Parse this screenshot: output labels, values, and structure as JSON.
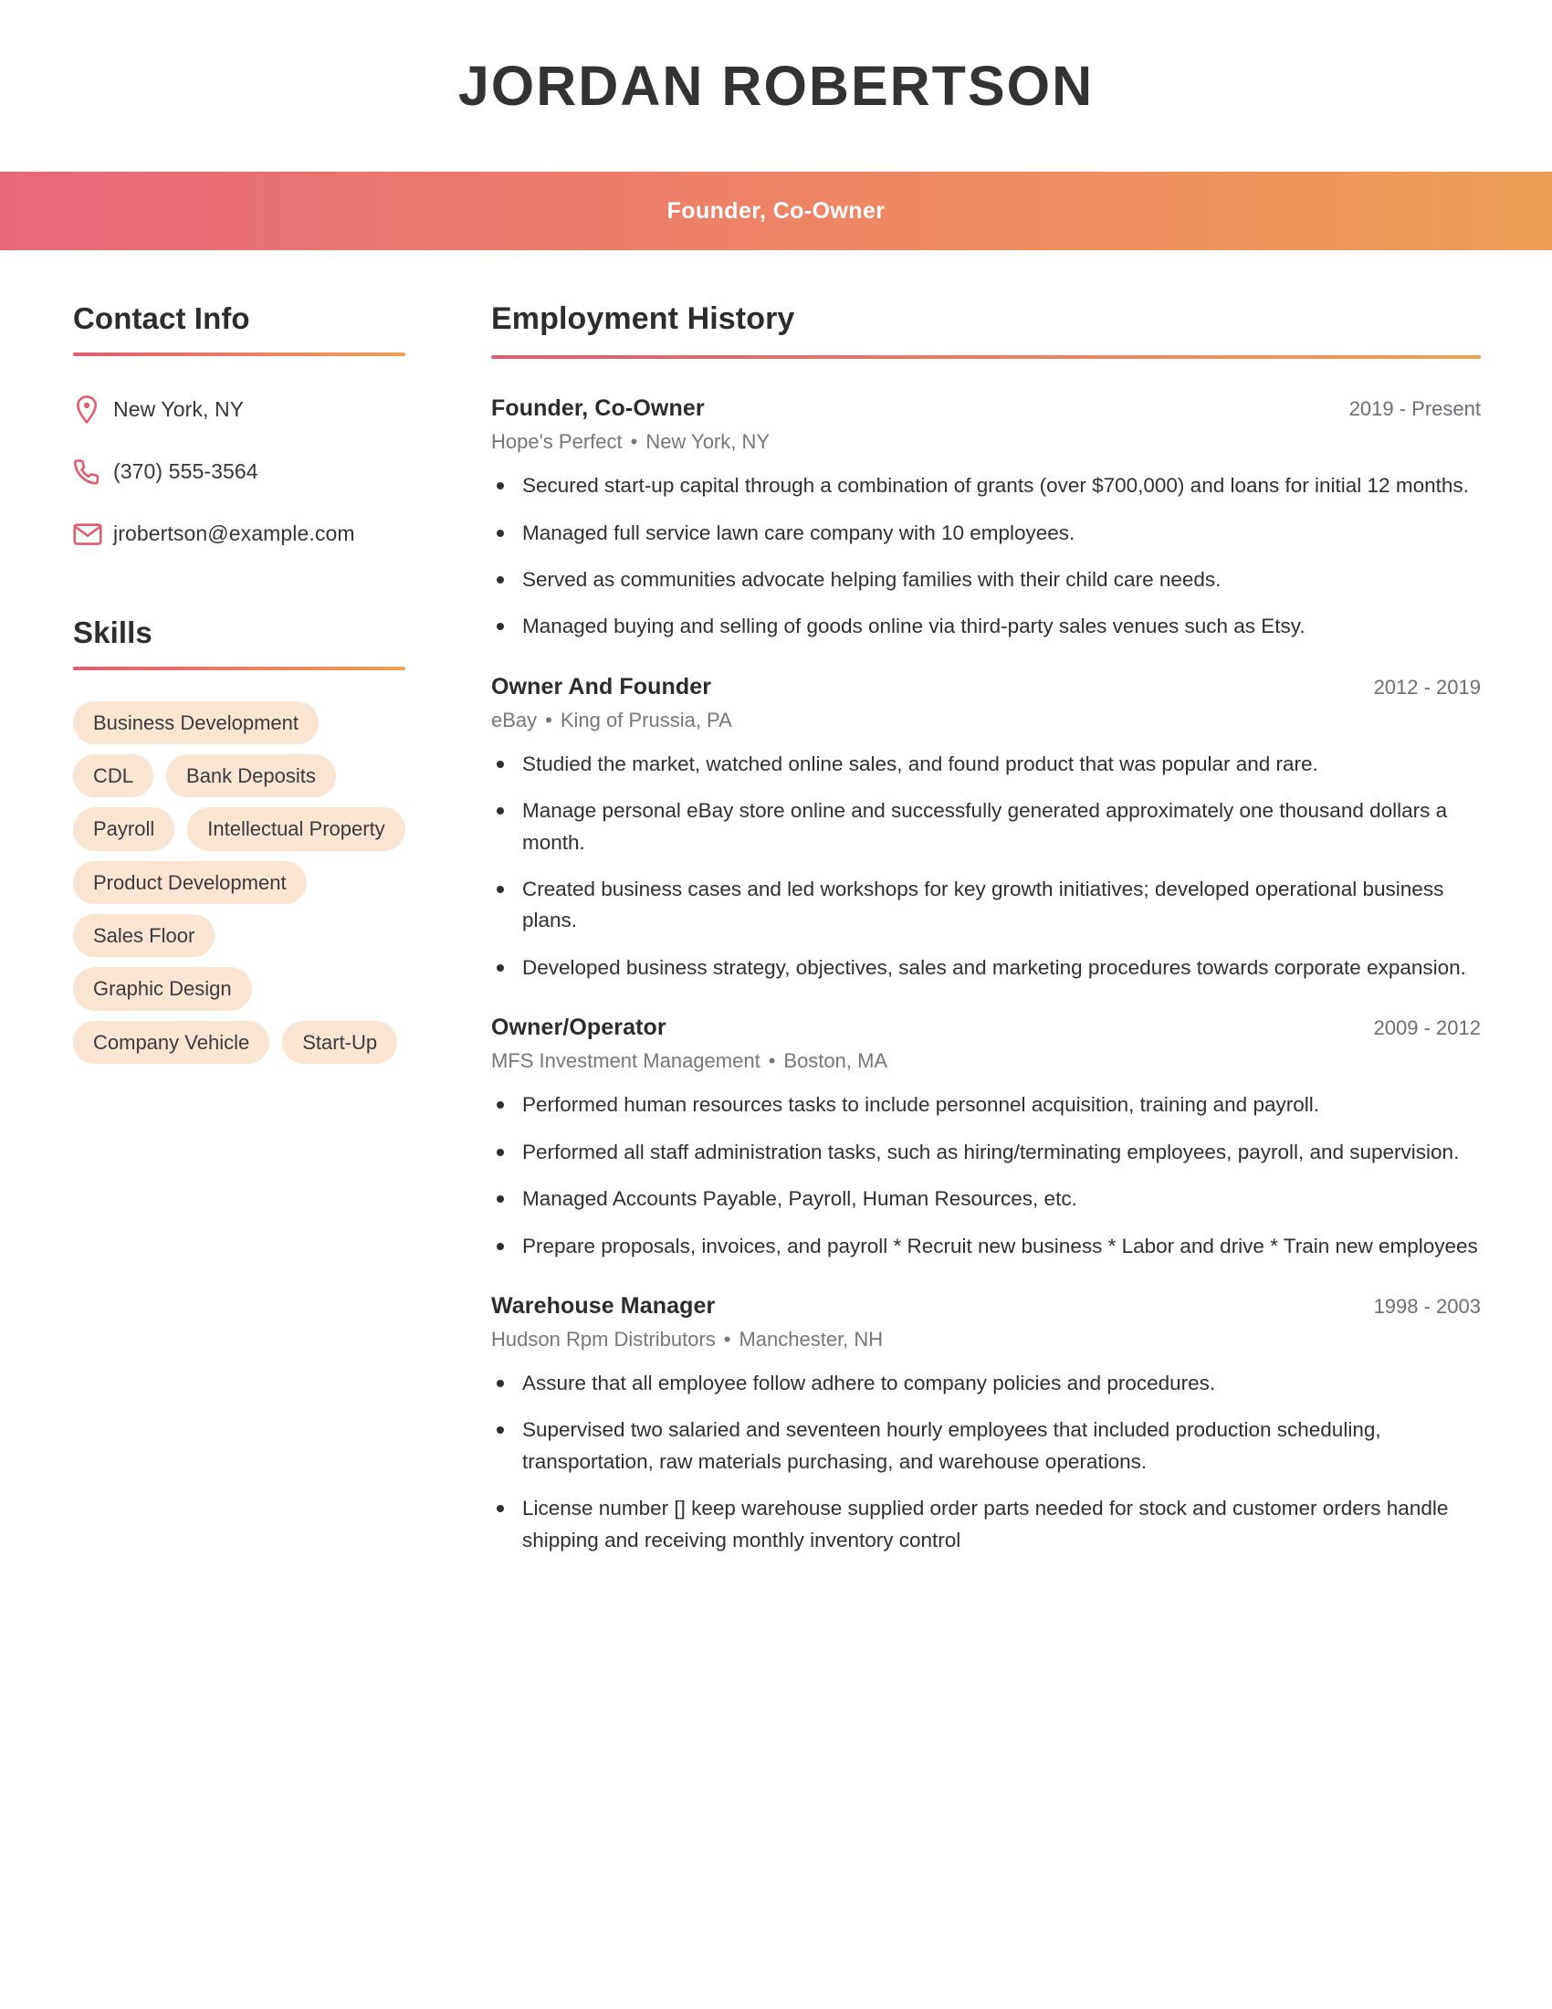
{
  "header": {
    "full_name": "JORDAN ROBERTSON",
    "job_title": "Founder, Co-Owner",
    "accent_start": "#e8687a",
    "accent_end": "#ed9d55"
  },
  "sidebar": {
    "contact": {
      "heading": "Contact Info",
      "items": [
        {
          "icon": "location-pin-icon",
          "value": "New York, NY"
        },
        {
          "icon": "phone-icon",
          "value": "(370) 555-3564"
        },
        {
          "icon": "envelope-icon",
          "value": "jrobertson@example.com"
        }
      ]
    },
    "skills": {
      "heading": "Skills",
      "tag_background": "#fae5d3",
      "items": [
        "Business Development",
        "CDL",
        "Bank Deposits",
        "Payroll",
        "Intellectual Property",
        "Product Development",
        "Sales Floor",
        "Graphic Design",
        "Company Vehicle",
        "Start-Up"
      ]
    }
  },
  "main": {
    "employment": {
      "heading": "Employment History",
      "jobs": [
        {
          "role": "Founder, Co-Owner",
          "dates": "2019 - Present",
          "company": "Hope's Perfect",
          "location": "New York, NY",
          "bullets": [
            "Secured start-up capital through a combination of grants (over $700,000) and loans for initial 12 months.",
            "Managed full service lawn care company with 10 employees.",
            "Served as communities advocate helping families with their child care needs.",
            "Managed buying and selling of goods online via third-party sales venues such as Etsy."
          ]
        },
        {
          "role": "Owner And Founder",
          "dates": "2012 - 2019",
          "company": "eBay",
          "location": "King of Prussia, PA",
          "bullets": [
            "Studied the market, watched online sales, and found product that was popular and rare.",
            "Manage personal eBay store online and successfully generated approximately one thousand dollars a month.",
            "Created business cases and led workshops for key growth initiatives; developed operational business plans.",
            "Developed business strategy, objectives, sales and marketing procedures towards corporate expansion."
          ]
        },
        {
          "role": "Owner/Operator",
          "dates": "2009 - 2012",
          "company": "MFS Investment Management",
          "location": "Boston, MA",
          "bullets": [
            "Performed human resources tasks to include personnel acquisition, training and payroll.",
            "Performed all staff administration tasks, such as hiring/terminating employees, payroll, and supervision.",
            "Managed Accounts Payable, Payroll, Human Resources, etc.",
            "Prepare proposals, invoices, and payroll * Recruit new business * Labor and drive * Train new employees"
          ]
        },
        {
          "role": "Warehouse Manager",
          "dates": "1998 - 2003",
          "company": "Hudson Rpm Distributors",
          "location": "Manchester, NH",
          "bullets": [
            "Assure that all employee follow adhere to company policies and procedures.",
            "Supervised two salaried and seventeen hourly employees that included production scheduling, transportation, raw materials purchasing, and warehouse operations.",
            "License number [] keep warehouse supplied order parts needed for stock and customer orders handle shipping and receiving monthly inventory control"
          ]
        }
      ]
    }
  },
  "separator": "•"
}
